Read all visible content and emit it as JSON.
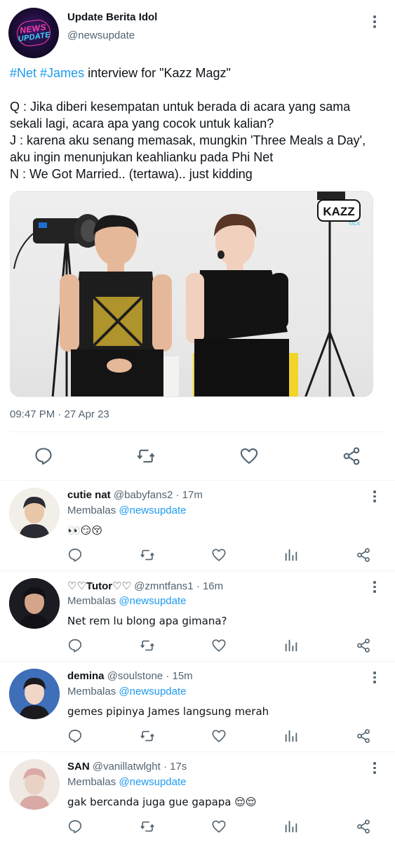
{
  "main_tweet": {
    "author_name": "Update Berita Idol",
    "author_handle": "@newsupdate",
    "avatar_logo_line1": "NEWS",
    "avatar_logo_line2": "UPDATE",
    "hashtag1": "#Net",
    "hashtag2": "#James",
    "headline_rest": " interview for \"Kazz Magz\"",
    "lines": [
      "Q : Jika diberi kesempatan untuk berada di acara yang sama",
      "sekali lagi, acara apa yang cocok untuk kalian?",
      "J : karena aku senang memasak, mungkin 'Three Meals a Day',",
      "aku ingin menunjukan keahlianku pada Phi Net",
      "N : We Got Married.. (tertawa).. just kidding"
    ],
    "media_logo_text": "KAZZ",
    "media_logo_sub": "TALK",
    "timestamp": "09:47 PM · 27 Apr 23"
  },
  "replies": [
    {
      "name": "cutie nat",
      "handle": "@babyfans2",
      "time": "· 17m",
      "replying_label": "Membalas",
      "replying_to": "@newsupdate",
      "text": "👀😏😚",
      "avatar_colors": [
        "#f2efe9",
        "#2b2b33",
        "#e8c6a8"
      ]
    },
    {
      "name": "♡♡Tutor♡♡",
      "handle": "@zmntfans1",
      "time": "· 16m",
      "replying_label": "Membalas",
      "replying_to": "@newsupdate",
      "text": "Net rem lu blong apa gimana?",
      "avatar_colors": [
        "#1b1b22",
        "#111116",
        "#d5a58a"
      ]
    },
    {
      "name": "demina",
      "handle": "@soulstone",
      "time": "· 15m",
      "replying_label": "Membalas",
      "replying_to": "@newsupdate",
      "text": "gemes pipinya James langsung merah",
      "avatar_colors": [
        "#3e6fb8",
        "#1d1a1f",
        "#f1d5c6"
      ]
    },
    {
      "name": "SAN",
      "handle": "@vanillatwlght",
      "time": "· 17s",
      "replying_label": "Membalas",
      "replying_to": "@newsupdate",
      "text": "gak bercanda juga gue gapapa 😌😌",
      "avatar_colors": [
        "#efe8e3",
        "#d9a9a5",
        "#e9d2c3"
      ]
    }
  ],
  "colors": {
    "accent": "#1d9bf0",
    "text": "#0f1419",
    "secondary": "#536471",
    "divider": "#eff3f4"
  },
  "icons": {
    "reply": "speech-bubble-icon",
    "retweet": "retweet-icon",
    "like": "heart-icon",
    "views": "bar-chart-icon",
    "share": "share-icon",
    "more": "vertical-dots-icon"
  }
}
